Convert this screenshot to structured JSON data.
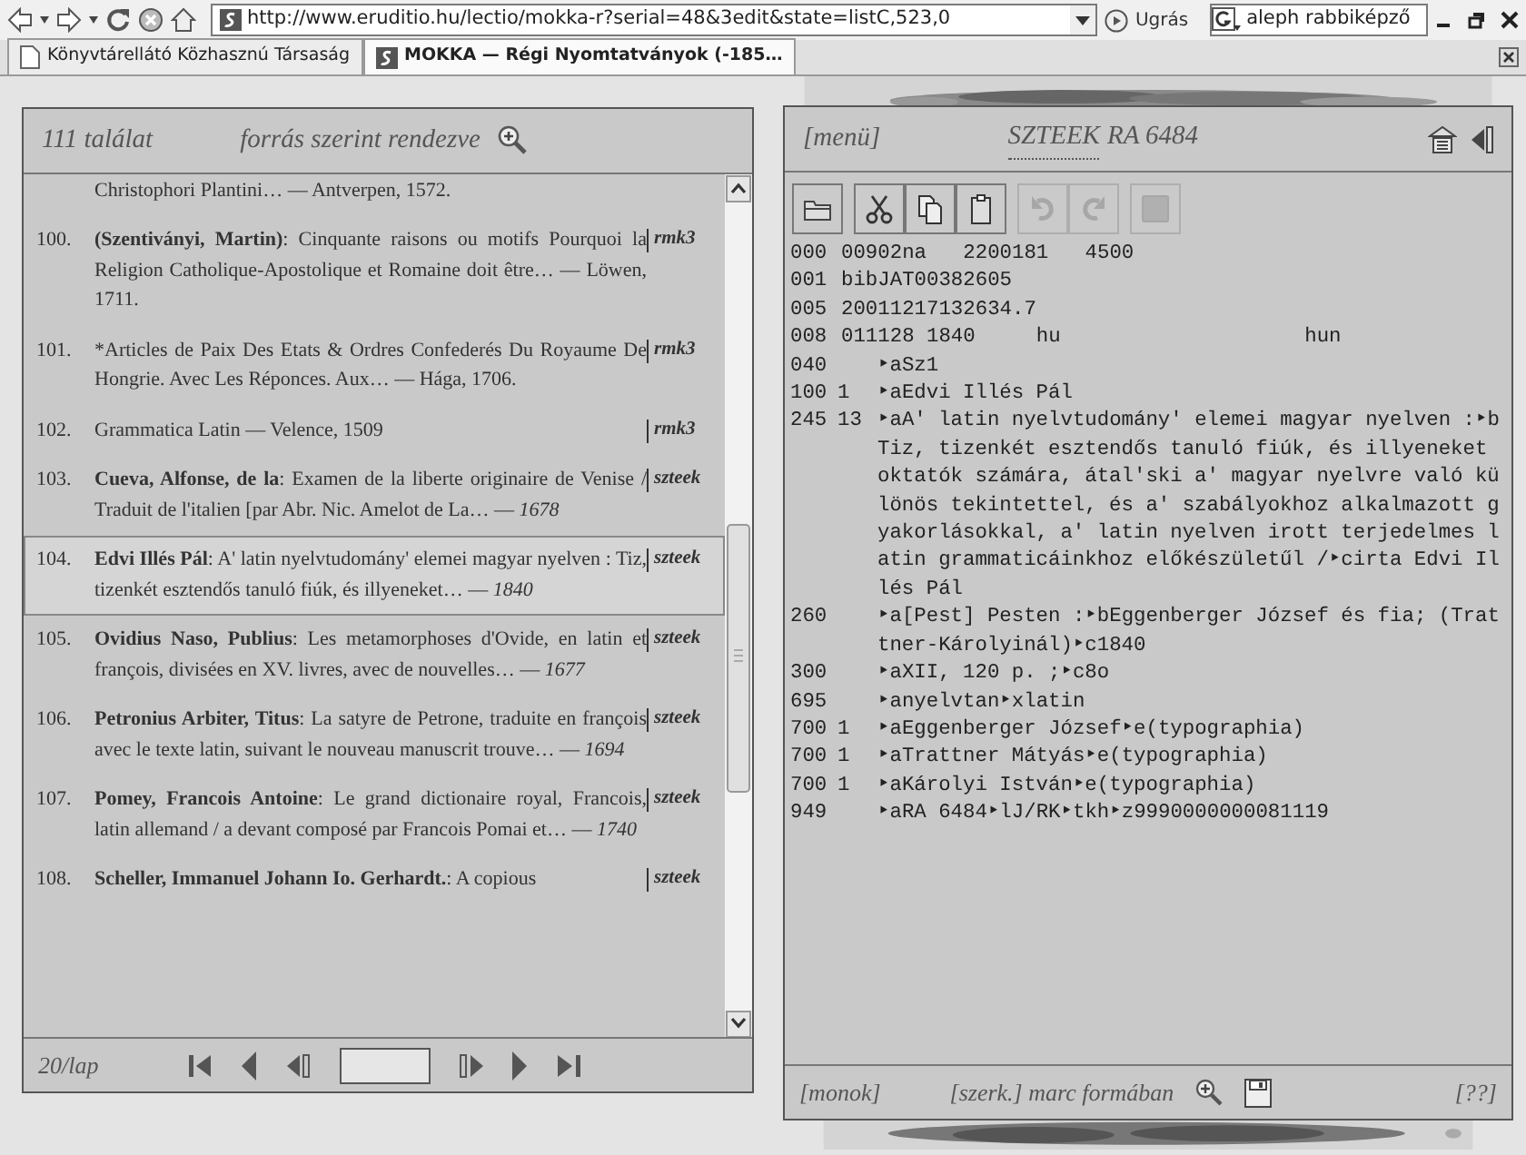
{
  "browser": {
    "url": "http://www.eruditio.hu/lectio/mokka-r?serial=48&3edit&state=listC,523,0",
    "go_label": "Ugrás",
    "search_value": "aleph rabbiképző",
    "tabs": [
      {
        "label": "Könyvtárellátó Közhasznú Társaság",
        "selected": false
      },
      {
        "label": "MOKKA — Régi Nyomtatványok (-185…",
        "selected": true
      }
    ]
  },
  "results_panel": {
    "count": "111 találat",
    "sort": "forrás szerint rendezve",
    "items": [
      {
        "text": "Christophori Plantini… — Antverpen, 1572.",
        "selected": false
      },
      {
        "number": "100.",
        "author": "(Szentiványi, Martin)",
        "text": ": Cinquante raisons ou motifs Pourquoi la Religion Catholique-Apostolique et Romaine doit être… — Löwen, 1711.",
        "source": "rmk3",
        "selected": false
      },
      {
        "number": "101.",
        "text": "*Articles de Paix Des Etats & Ordres Confederés Du Royaume De Hongrie. Avec Les Réponces. Aux… — Hága, 1706.",
        "source": "rmk3",
        "selected": false
      },
      {
        "number": "102.",
        "text": "Grammatica Latin — Velence, 1509",
        "source": "rmk3",
        "selected": false
      },
      {
        "number": "103.",
        "author": "Cueva, Alfonse, de la",
        "text": ": Examen de la liberte originaire de Venise / Traduit de l'italien [par Abr. Nic. Amelot de La… —",
        "year": "1678",
        "source": "szteek",
        "selected": false
      },
      {
        "number": "104.",
        "author": "Edvi Illés Pál",
        "text": ": A' latin nyelvtudomány' elemei magyar nyelven : Tiz, tizenkét esztendős tanuló fiúk, és illyeneket… —",
        "year": "1840",
        "source": "szteek",
        "selected": true
      },
      {
        "number": "105.",
        "author": "Ovidius Naso, Publius",
        "text": ": Les metamorphoses d'Ovide, en latin et françois, divisées en XV. livres, avec de nouvelles… —",
        "year": "1677",
        "source": "szteek",
        "selected": false
      },
      {
        "number": "106.",
        "author": "Petronius Arbiter, Titus",
        "text": ": La satyre de Petrone, traduite en françois avec le texte latin, suivant le nouveau manuscrit trouve… —",
        "year": "1694",
        "source": "szteek",
        "selected": false
      },
      {
        "number": "107.",
        "author": "Pomey, Francois Antoine",
        "text": ": Le grand dictionaire royal, Francois, latin allemand / a devant composé par Francois Pomai et… —",
        "year": "1740",
        "source": "szteek",
        "selected": false
      },
      {
        "number": "108.",
        "author": "Scheller, Immanuel Johann Io. Gerhardt.",
        "text": ": A copious",
        "source": "szteek",
        "selected": false
      }
    ],
    "per_page": "20/lap"
  },
  "record_panel": {
    "menu": "[menü]",
    "title_link": "SZTEEK",
    "title_rest": "RA 6484",
    "toolbar": [
      {
        "kind": "open",
        "disabled": false
      },
      {
        "kind": "cut",
        "disabled": false
      },
      {
        "kind": "copy",
        "disabled": false
      },
      {
        "kind": "paste",
        "disabled": false
      },
      {
        "kind": "undo",
        "disabled": true
      },
      {
        "kind": "redo",
        "disabled": true
      },
      {
        "kind": "save",
        "disabled": true
      }
    ],
    "fields": [
      {
        "tag": "000",
        "kind": "control",
        "content": "00902na   2200181   4500"
      },
      {
        "tag": "001",
        "kind": "control",
        "content": "bibJAT00382605"
      },
      {
        "tag": "005",
        "kind": "control",
        "content": "20011217132634.7"
      },
      {
        "tag": "008",
        "kind": "control",
        "content": "011128 1840     hu                    hun"
      },
      {
        "tag": "040",
        "kind": "data",
        "content": "‣aSz1"
      },
      {
        "tag": "100",
        "kind": "data",
        "ind": "1",
        "content": "‣aEdvi Illés Pál"
      },
      {
        "tag": "245",
        "kind": "data",
        "ind": "13",
        "content": "‣aA' latin nyelvtudomány' elemei magyar nyelven :‣bTiz, tizenkét esztendős tanuló fiúk, és illyeneket oktatók számára, átal'ski a' magyar nyelvre való különös tekintettel, és a' szabályokhoz alkalmazott gyakorlásokkal, a' latin nyelven irott terjedelmes latin grammaticáinkhoz előkészületűl /‣cirta Edvi Illés Pál"
      },
      {
        "tag": "260",
        "kind": "data",
        "content": "‣a[Pest] Pesten :‣bEggenberger József és fia; (Trattner-Károlyinál)‣c1840"
      },
      {
        "tag": "300",
        "kind": "data",
        "content": "‣aXII, 120 p. ;‣c8o"
      },
      {
        "tag": "695",
        "kind": "data",
        "content": "‣anyelvtan‣xlatin"
      },
      {
        "tag": "700",
        "kind": "data",
        "ind": "1",
        "content": "‣aEggenberger József‣e(typographia)"
      },
      {
        "tag": "700",
        "kind": "data",
        "ind": "1",
        "content": "‣aTrattner Mátyás‣e(typographia)"
      },
      {
        "tag": "700",
        "kind": "data",
        "ind": "1",
        "content": "‣aKárolyi István‣e(typographia)"
      },
      {
        "tag": "949",
        "kind": "data",
        "content": "‣aRA 6484‣lJ/RK‣tkh‣z9990000000081119"
      }
    ],
    "footer_left": "[monok]",
    "footer_center": "[szerk.] marc formában",
    "footer_right": "[??]"
  }
}
